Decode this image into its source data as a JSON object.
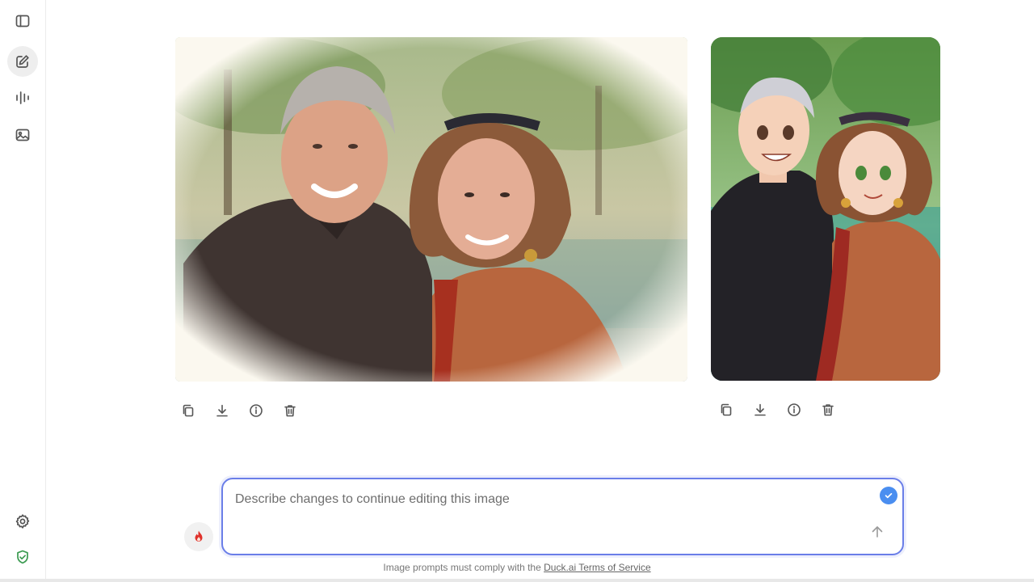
{
  "sidebar": {
    "items": [
      {
        "name": "toggle-sidebar",
        "icon": "sidebar-icon"
      },
      {
        "name": "new-chat",
        "icon": "edit-icon",
        "active": true
      },
      {
        "name": "voice",
        "icon": "waveform-icon"
      },
      {
        "name": "images",
        "icon": "image-icon"
      }
    ],
    "bottom": [
      {
        "name": "settings",
        "icon": "gear-icon"
      },
      {
        "name": "privacy",
        "icon": "shield-check-icon"
      }
    ]
  },
  "images": [
    {
      "style": "watercolor",
      "actions": [
        "copy-icon",
        "download-icon",
        "info-icon",
        "trash-icon"
      ]
    },
    {
      "style": "anime",
      "actions": [
        "copy-icon",
        "download-icon",
        "info-icon",
        "trash-icon"
      ]
    }
  ],
  "composer": {
    "placeholder": "Describe changes to continue editing this image",
    "value": ""
  },
  "footer": {
    "text": "Image prompts must comply with the ",
    "link": "Duck.ai Terms of Service"
  },
  "colors": {
    "accent": "#6a7ee8",
    "check": "#4a8ef0",
    "fire": "#e0312b"
  }
}
